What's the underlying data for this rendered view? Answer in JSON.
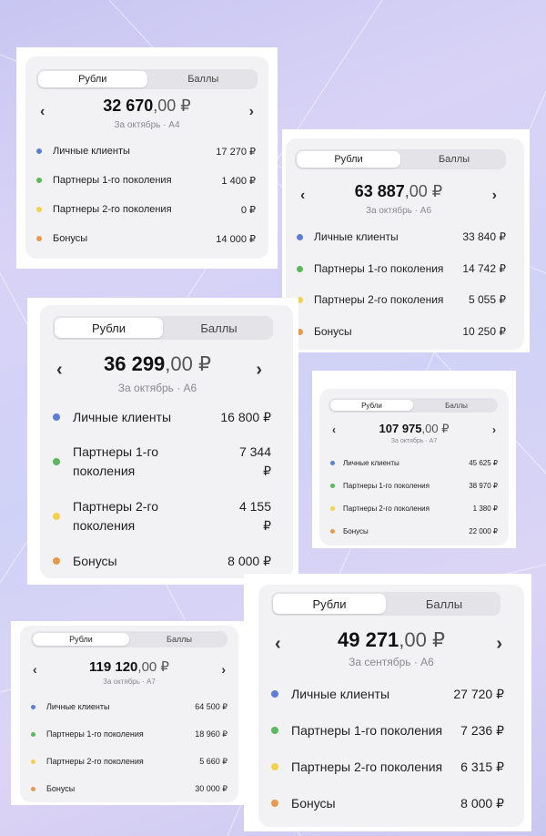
{
  "colors": {
    "blue": "#5b7fd6",
    "green": "#5cb85c",
    "yellow": "#f2d24b",
    "orange": "#e79a4b"
  },
  "cards": [
    {
      "tab_active": "Рубли",
      "tab_inactive": "Баллы",
      "amount_main": "32 670",
      "amount_dec": ",00 ₽",
      "subtitle": "За октябрь · А4",
      "items": [
        {
          "label": "Личные клиенты",
          "value": "17 270 ₽",
          "color": "blue"
        },
        {
          "label": "Партнеры 1-го поколения",
          "value": "1 400 ₽",
          "color": "green"
        },
        {
          "label": "Партнеры 2-го поколения",
          "value": "0 ₽",
          "color": "yellow"
        },
        {
          "label": "Бонусы",
          "value": "14 000 ₽",
          "color": "orange"
        }
      ]
    },
    {
      "tab_active": "Рубли",
      "tab_inactive": "Баллы",
      "amount_main": "63 887",
      "amount_dec": ",00 ₽",
      "subtitle": "За октябрь · А6",
      "items": [
        {
          "label": "Личные клиенты",
          "value": "33 840 ₽",
          "color": "blue"
        },
        {
          "label": "Партнеры 1-го поколения",
          "value": "14 742 ₽",
          "color": "green"
        },
        {
          "label": "Партнеры 2-го поколения",
          "value": "5 055 ₽",
          "color": "yellow"
        },
        {
          "label": "Бонусы",
          "value": "10 250 ₽",
          "color": "orange"
        }
      ]
    },
    {
      "tab_active": "Рубли",
      "tab_inactive": "Баллы",
      "amount_main": "36 299",
      "amount_dec": ",00 ₽",
      "subtitle": "За октябрь · А6",
      "items": [
        {
          "label": "Личные клиенты",
          "value": "16 800 ₽",
          "color": "blue"
        },
        {
          "label": "Партнеры 1-го поколения",
          "value": "7 344 ₽",
          "color": "green"
        },
        {
          "label": "Партнеры 2-го поколения",
          "value": "4 155 ₽",
          "color": "yellow"
        },
        {
          "label": "Бонусы",
          "value": "8 000 ₽",
          "color": "orange"
        }
      ]
    },
    {
      "tab_active": "Рубли",
      "tab_inactive": "Баллы",
      "amount_main": "107 975",
      "amount_dec": ",00 ₽",
      "subtitle": "За октябрь · А7",
      "items": [
        {
          "label": "Личные клиенты",
          "value": "45 625 ₽",
          "color": "blue"
        },
        {
          "label": "Партнеры 1-го поколения",
          "value": "38 970 ₽",
          "color": "green"
        },
        {
          "label": "Партнеры 2-го поколения",
          "value": "1 380 ₽",
          "color": "yellow"
        },
        {
          "label": "Бонусы",
          "value": "22 000 ₽",
          "color": "orange"
        }
      ]
    },
    {
      "tab_active": "Рубли",
      "tab_inactive": "Баллы",
      "amount_main": "119 120",
      "amount_dec": ",00 ₽",
      "subtitle": "За октябрь · А7",
      "items": [
        {
          "label": "Личные клиенты",
          "value": "64 500 ₽",
          "color": "blue"
        },
        {
          "label": "Партнеры 1-го поколения",
          "value": "18 960 ₽",
          "color": "green"
        },
        {
          "label": "Партнеры 2-го поколения",
          "value": "5 660 ₽",
          "color": "yellow"
        },
        {
          "label": "Бонусы",
          "value": "30 000 ₽",
          "color": "orange"
        }
      ]
    },
    {
      "tab_active": "Рубли",
      "tab_inactive": "Баллы",
      "amount_main": "49 271",
      "amount_dec": ",00 ₽",
      "subtitle": "За сентябрь · А6",
      "items": [
        {
          "label": "Личные клиенты",
          "value": "27 720 ₽",
          "color": "blue"
        },
        {
          "label": "Партнеры 1-го поколения",
          "value": "7 236 ₽",
          "color": "green"
        },
        {
          "label": "Партнеры 2-го поколения",
          "value": "6 315 ₽",
          "color": "yellow"
        },
        {
          "label": "Бонусы",
          "value": "8 000 ₽",
          "color": "orange"
        }
      ]
    }
  ]
}
